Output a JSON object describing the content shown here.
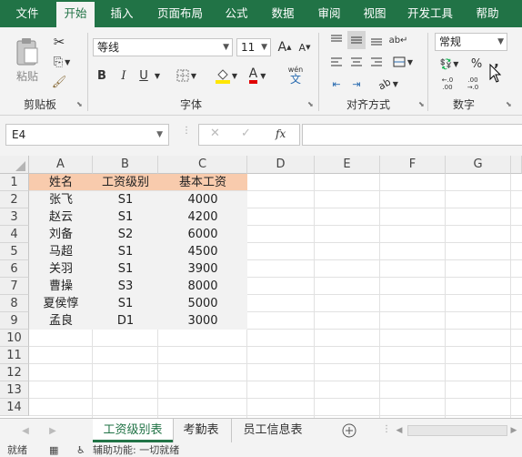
{
  "ribbon_tabs": [
    "文件",
    "开始",
    "插入",
    "页面布局",
    "公式",
    "数据",
    "审阅",
    "视图",
    "开发工具",
    "帮助"
  ],
  "active_tab": "开始",
  "clipboard": {
    "paste_label": "粘贴",
    "group_label": "剪贴板"
  },
  "font": {
    "name": "等线",
    "size": "11",
    "group_label": "字体",
    "grow": "A",
    "shrink": "A",
    "bold": "B",
    "italic": "I",
    "underline": "U",
    "font_color_letter": "A",
    "phonetic": "wén"
  },
  "alignment": {
    "group_label": "对齐方式"
  },
  "number": {
    "format": "常规",
    "percent": "%",
    "comma": ",",
    "group_label": "数字",
    "inc_decimal": ".0→.00",
    "dec_decimal": ".00→.0"
  },
  "formula_bar": {
    "name_box": "E4",
    "fx": "fx",
    "value": ""
  },
  "columns": [
    "A",
    "B",
    "C",
    "D",
    "E",
    "F",
    "G"
  ],
  "rows": [
    "1",
    "2",
    "3",
    "4",
    "5",
    "6",
    "7",
    "8",
    "9",
    "10",
    "11",
    "12",
    "13",
    "14"
  ],
  "table": {
    "headers": [
      "姓名",
      "工资级别",
      "基本工资"
    ],
    "rows": [
      [
        "张飞",
        "S1",
        "4000"
      ],
      [
        "赵云",
        "S1",
        "4200"
      ],
      [
        "刘备",
        "S2",
        "6000"
      ],
      [
        "马超",
        "S1",
        "4500"
      ],
      [
        "关羽",
        "S1",
        "3900"
      ],
      [
        "曹操",
        "S3",
        "8000"
      ],
      [
        "夏侯惇",
        "S1",
        "5000"
      ],
      [
        "孟良",
        "D1",
        "3000"
      ]
    ]
  },
  "sheets": [
    "工资级别表",
    "考勤表",
    "员工信息表"
  ],
  "active_sheet": "工资级别表",
  "status": {
    "ready": "就绪",
    "accessibility": "辅助功能: 一切就绪"
  },
  "colors": {
    "accent": "#217346",
    "header_fill": "#f8cbad",
    "data_fill": "#f2f2f2"
  }
}
